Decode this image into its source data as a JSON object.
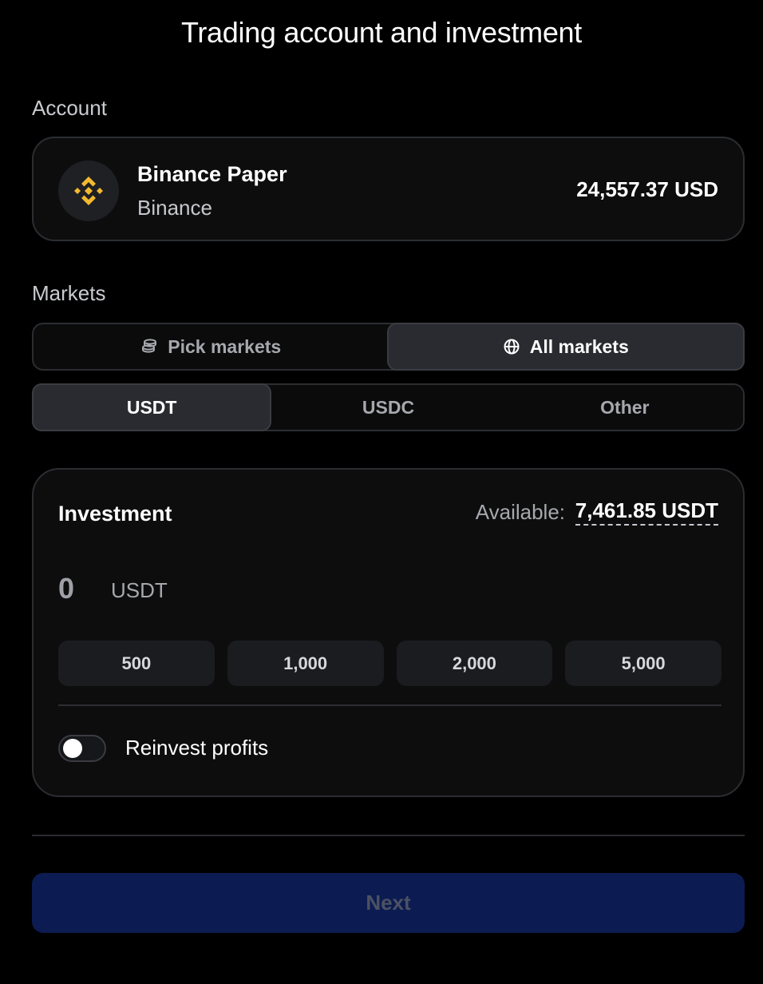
{
  "page": {
    "title": "Trading account and investment"
  },
  "account": {
    "section_label": "Account",
    "name": "Binance Paper",
    "exchange": "Binance",
    "balance": "24,557.37 USD",
    "logo_icon": "binance-logo-icon",
    "logo_color": "#f3ba2f"
  },
  "markets": {
    "section_label": "Markets",
    "mode_options": [
      {
        "label": "Pick markets",
        "icon": "coins-stack-icon",
        "selected": false
      },
      {
        "label": "All markets",
        "icon": "globe-icon",
        "selected": true
      }
    ],
    "quote_options": [
      {
        "label": "USDT",
        "selected": true
      },
      {
        "label": "USDC",
        "selected": false
      },
      {
        "label": "Other",
        "selected": false
      }
    ]
  },
  "investment": {
    "title": "Investment",
    "available_label": "Available:",
    "available_value": "7,461.85 USDT",
    "amount_placeholder": "0",
    "amount_unit": "USDT",
    "presets": [
      "500",
      "1,000",
      "2,000",
      "5,000"
    ],
    "reinvest_label": "Reinvest profits",
    "reinvest_enabled": false
  },
  "footer": {
    "next_label": "Next",
    "next_enabled": false
  },
  "colors": {
    "background": "#000000",
    "card": "#0d0d0e",
    "border": "#2b2d31",
    "next_button": "#0c1c52"
  }
}
